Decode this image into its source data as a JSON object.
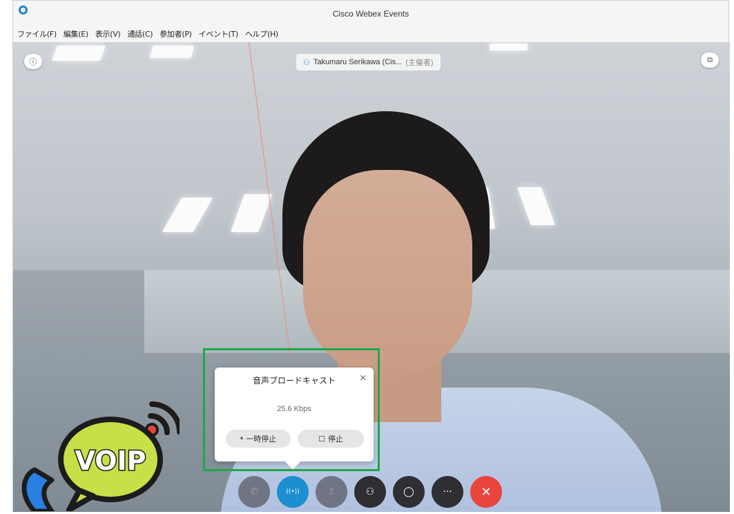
{
  "window": {
    "title": "Cisco Webex Events"
  },
  "menu": {
    "items": [
      "ファイル(F)",
      "編集(E)",
      "表示(V)",
      "通話(C)",
      "参加者(P)",
      "イベント(T)",
      "ヘルプ(H)"
    ]
  },
  "video": {
    "presenter_name": "Takumaru Serikawa (Cis...",
    "presenter_role": "(主催者)",
    "info_icon": "info-icon",
    "popout_icon": "popout-icon"
  },
  "broadcast_popup": {
    "title": "音声ブロードキャスト",
    "close": "×",
    "bitrate": "25.6 Kbps",
    "pause_label": "一時停止",
    "pause_symbol": "⏸",
    "stop_label": "停止",
    "stop_symbol": "☐"
  },
  "toolbar": {
    "buttons": [
      {
        "name": "phone-icon",
        "glyph": "✆"
      },
      {
        "name": "broadcast-icon",
        "glyph": "((•))"
      },
      {
        "name": "share-icon",
        "glyph": "⇧"
      },
      {
        "name": "participants-icon",
        "glyph": "⚇"
      },
      {
        "name": "chat-icon",
        "glyph": "◯"
      },
      {
        "name": "more-icon",
        "glyph": "···"
      },
      {
        "name": "end-call-icon",
        "glyph": "✕"
      }
    ]
  },
  "overlay": {
    "voip_label": "VOIP",
    "voip_color": "#c7e047",
    "outline_color": "#1fa64a"
  }
}
